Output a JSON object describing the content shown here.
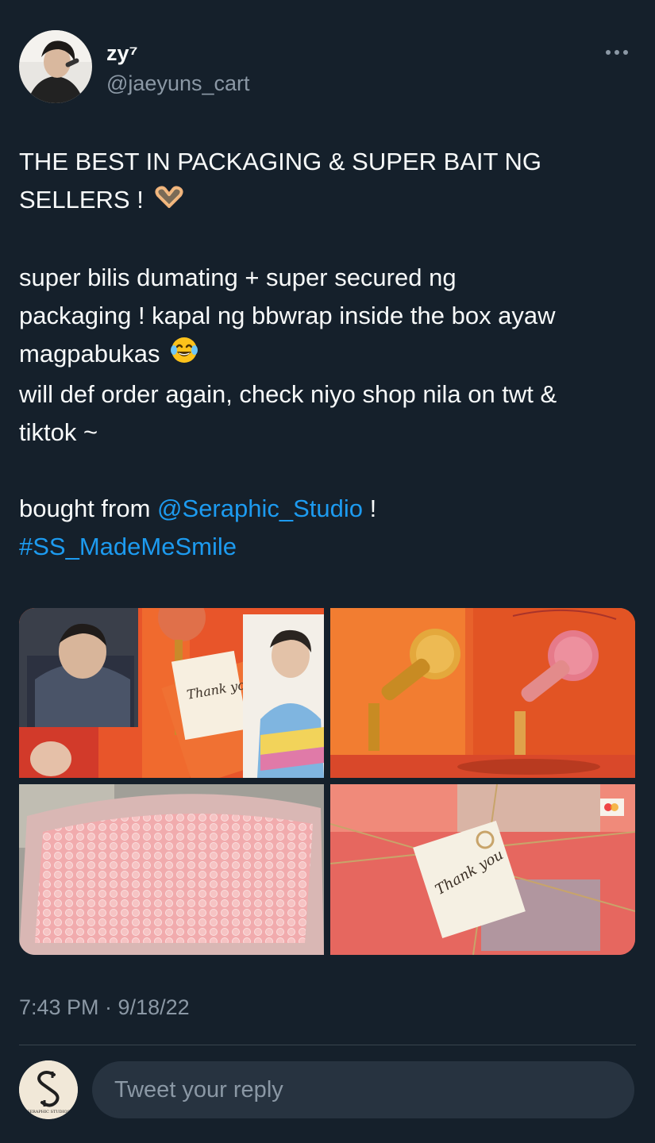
{
  "author": {
    "display_name": "zy⁷",
    "handle": "@jaeyuns_cart"
  },
  "tweet": {
    "line1": "THE BEST IN PACKAGING & SUPER BAIT NG",
    "line2": "SELLERS !",
    "line3": "super bilis dumating + super secured ng",
    "line4": "packaging ! kapal ng bbwrap inside the box ayaw",
    "line5": "magpabukas",
    "line6": "will def order again, check niyo shop nila on twt &",
    "line7": "tiktok ~",
    "bought_prefix": "bought from ",
    "mention": "@Seraphic_Studio",
    "bought_suffix": " !",
    "hashtag": "#SS_MadeMeSmile",
    "timestamp": "7:43 PM · 9/18/22"
  },
  "icons": {
    "heart_hands": "heart-hands-emoji",
    "laughing": "tears-of-joy-emoji",
    "more": "more-icon"
  },
  "reply": {
    "placeholder": "Tweet your reply",
    "avatar_brand": "SERAPHIC STUDIOS"
  },
  "colors": {
    "background": "#15202b",
    "link": "#1d9bf0",
    "secondary_text": "#8b98a5",
    "input_bg": "#273340"
  }
}
